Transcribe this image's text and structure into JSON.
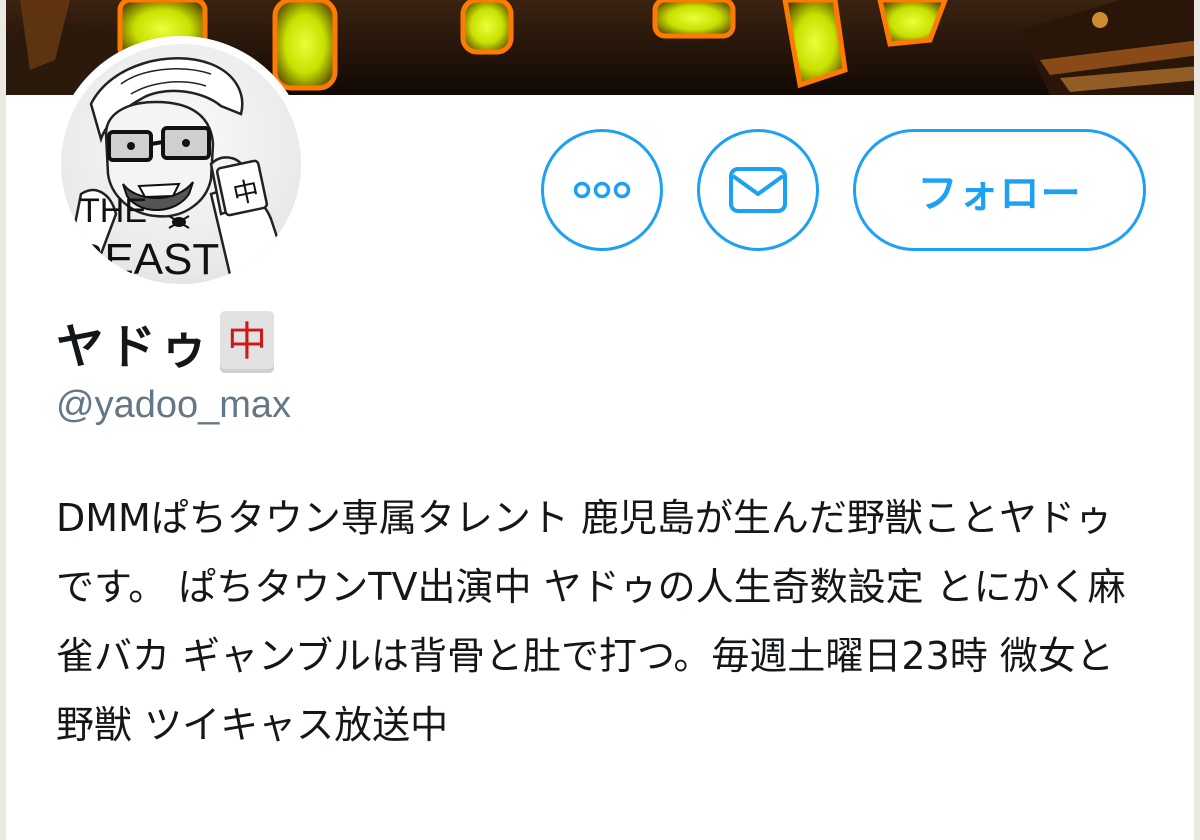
{
  "profile": {
    "banner": {
      "description_icon": "event-banner-photo"
    },
    "avatar": {
      "icon": "the-beast-caricature-avatar"
    },
    "actions": {
      "more_icon": "more-dots-icon",
      "message_icon": "envelope-icon",
      "follow_label": "フォロー"
    },
    "display_name": "ヤドゥ",
    "name_emoji": "中",
    "handle": "@yadoo_max",
    "bio": "DMMぱちタウン専属タレント 鹿児島が生んだ野獣ことヤドゥです。 ぱちタウンTV出演中 ヤドゥの人生奇数設定 とにかく麻雀バカ ギャンブルは背骨と肚で打つ。毎週土曜日23時 微女と野獣 ツイキャス放送中"
  },
  "colors": {
    "accent": "#1da1f2",
    "text_primary": "#14171a",
    "text_secondary": "#657786",
    "tile_red": "#cc1a1a"
  },
  "avatar_text": {
    "line1": "THE",
    "line2": "BEAST",
    "tile_char": "中"
  }
}
